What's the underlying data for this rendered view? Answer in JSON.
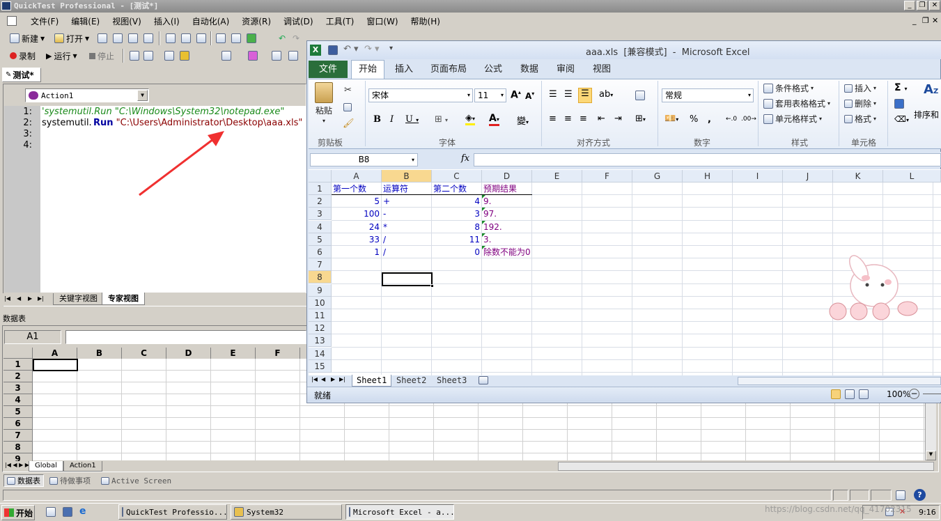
{
  "qtp": {
    "title": "QuickTest Professional - [测试*]",
    "menu": [
      "文件(F)",
      "编辑(E)",
      "视图(V)",
      "插入(I)",
      "自动化(A)",
      "资源(R)",
      "调试(D)",
      "工具(T)",
      "窗口(W)",
      "帮助(H)"
    ],
    "toolbar1": {
      "new": "新建",
      "open": "打开"
    },
    "toolbar2": {
      "record": "录制",
      "run": "运行",
      "stop": "停止"
    },
    "doc_tab": "测试*",
    "action_select": "Action1",
    "code_lines": [
      {
        "num": "1:",
        "text": "'systemutil.Run \"C:\\Windows\\System32\\notepad.exe\""
      },
      {
        "num": "2:",
        "obj": "systemutil.",
        "method": "Run",
        "str": " \"C:\\Users\\Administrator\\Desktop\\aaa.xls\""
      },
      {
        "num": "3:",
        "text": ""
      },
      {
        "num": "4:",
        "text": ""
      }
    ],
    "view_tabs": [
      "关键字视图",
      "专家视图"
    ],
    "datatable_title": "数据表",
    "datatable_cellref": "A1",
    "datatable_cols": [
      "A",
      "B",
      "C",
      "D",
      "E",
      "F"
    ],
    "datatable_rows": [
      "1",
      "2",
      "3",
      "4",
      "5",
      "6",
      "7",
      "8",
      "9"
    ],
    "datatable_sheets": [
      "Global",
      "Action1"
    ],
    "bottom_tabs": [
      "数据表",
      "待做事项",
      "Active Screen"
    ]
  },
  "excel": {
    "title": "aaa.xls  [兼容模式]  -  Microsoft Excel",
    "ribbon_tabs": [
      "文件",
      "开始",
      "插入",
      "页面布局",
      "公式",
      "数据",
      "审阅",
      "视图"
    ],
    "font_name": "宋体",
    "font_size": "11",
    "number_format": "常规",
    "buttons": {
      "paste": "粘贴",
      "cond_format": "条件格式",
      "table_format": "套用表格格式",
      "cell_style": "单元格样式",
      "insert": "插入",
      "delete": "删除",
      "format": "格式",
      "sort": "排序和"
    },
    "groups": [
      "剪贴板",
      "字体",
      "对齐方式",
      "数字",
      "样式",
      "单元格"
    ],
    "name_box": "B8",
    "fx": "fx",
    "columns": [
      "A",
      "B",
      "C",
      "D",
      "E",
      "F",
      "G",
      "H",
      "I",
      "J",
      "K",
      "L"
    ],
    "rows": [
      [
        "第一个数",
        "运算符",
        "第二个数",
        "预期结果"
      ],
      [
        "5",
        "+",
        "4",
        "9."
      ],
      [
        "100",
        "-",
        "3",
        "97."
      ],
      [
        "24",
        "*",
        "8",
        "192."
      ],
      [
        "33",
        "/",
        "11",
        "3."
      ],
      [
        "1",
        "/",
        "0",
        "除数不能为0"
      ],
      [],
      [],
      [],
      [],
      [],
      [],
      [],
      [],
      []
    ],
    "row_numbers": [
      "1",
      "2",
      "3",
      "4",
      "5",
      "6",
      "7",
      "8",
      "9",
      "10",
      "11",
      "12",
      "13",
      "14",
      "15"
    ],
    "sheets": [
      "Sheet1",
      "Sheet2",
      "Sheet3"
    ],
    "status": "就绪",
    "zoom": "100%"
  },
  "taskbar": {
    "start": "开始",
    "items": [
      "QuickTest Professio...",
      "System32",
      "Microsoft Excel - a..."
    ],
    "clock": "9:16",
    "watermark": "https://blog.csdn.net/qq_41702315"
  }
}
